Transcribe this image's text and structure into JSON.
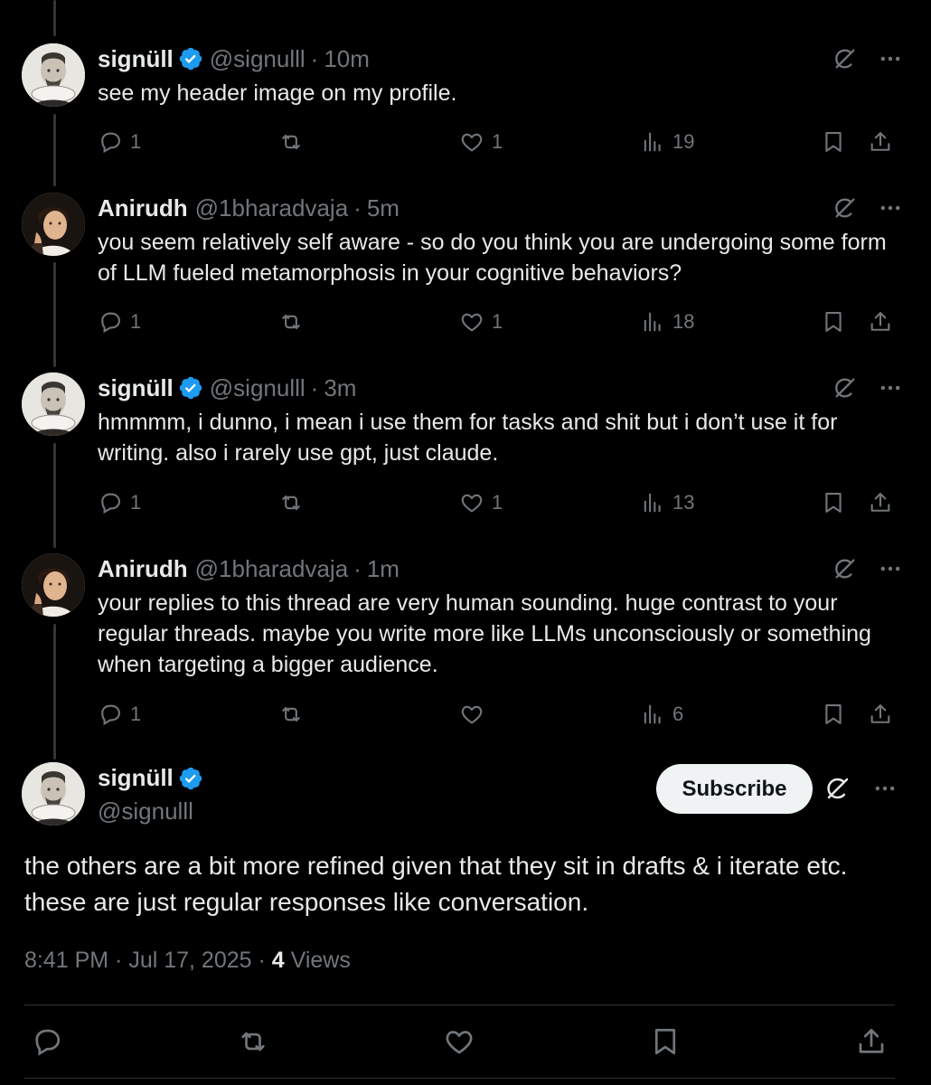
{
  "replies": [
    {
      "name": "signüll",
      "verified": true,
      "handle": "@signulll",
      "time": "10m",
      "text": "see my header image on my profile.",
      "stats": {
        "replies": "1",
        "reposts": "",
        "likes": "1",
        "views": "19"
      }
    },
    {
      "name": "Anirudh",
      "verified": false,
      "handle": "@1bharadvaja",
      "time": "5m",
      "text": "you seem relatively self aware - so do you think you are undergoing some form of LLM fueled metamorphosis in your cognitive behaviors?",
      "stats": {
        "replies": "1",
        "reposts": "",
        "likes": "1",
        "views": "18"
      }
    },
    {
      "name": "signüll",
      "verified": true,
      "handle": "@signulll",
      "time": "3m",
      "text": "hmmmm, i dunno, i mean i use them for tasks and shit but i don’t use it for writing. also i rarely use gpt, just claude.",
      "stats": {
        "replies": "1",
        "reposts": "",
        "likes": "1",
        "views": "13"
      }
    },
    {
      "name": "Anirudh",
      "verified": false,
      "handle": "@1bharadvaja",
      "time": "1m",
      "text": "your replies to this thread are very human sounding. huge contrast to your regular threads. maybe you write more like LLMs unconsciously or something when targeting a bigger audience.",
      "stats": {
        "replies": "1",
        "reposts": "",
        "likes": "",
        "views": "6"
      }
    }
  ],
  "main_post": {
    "name": "signüll",
    "handle": "@signulll",
    "subscribe_label": "Subscribe",
    "text": "the others are a bit more refined given that they sit in drafts & i iterate etc. these are just regular responses like conversation.",
    "datetime": "8:41 PM · Jul 17, 2025 · ",
    "views_count": "4",
    "views_label": "Views"
  },
  "colors": {
    "background": "#000000",
    "text": "#e7e9ea",
    "muted": "#71767b",
    "verified": "#1d9bf0",
    "divider": "#2f3336"
  },
  "separator": "·"
}
